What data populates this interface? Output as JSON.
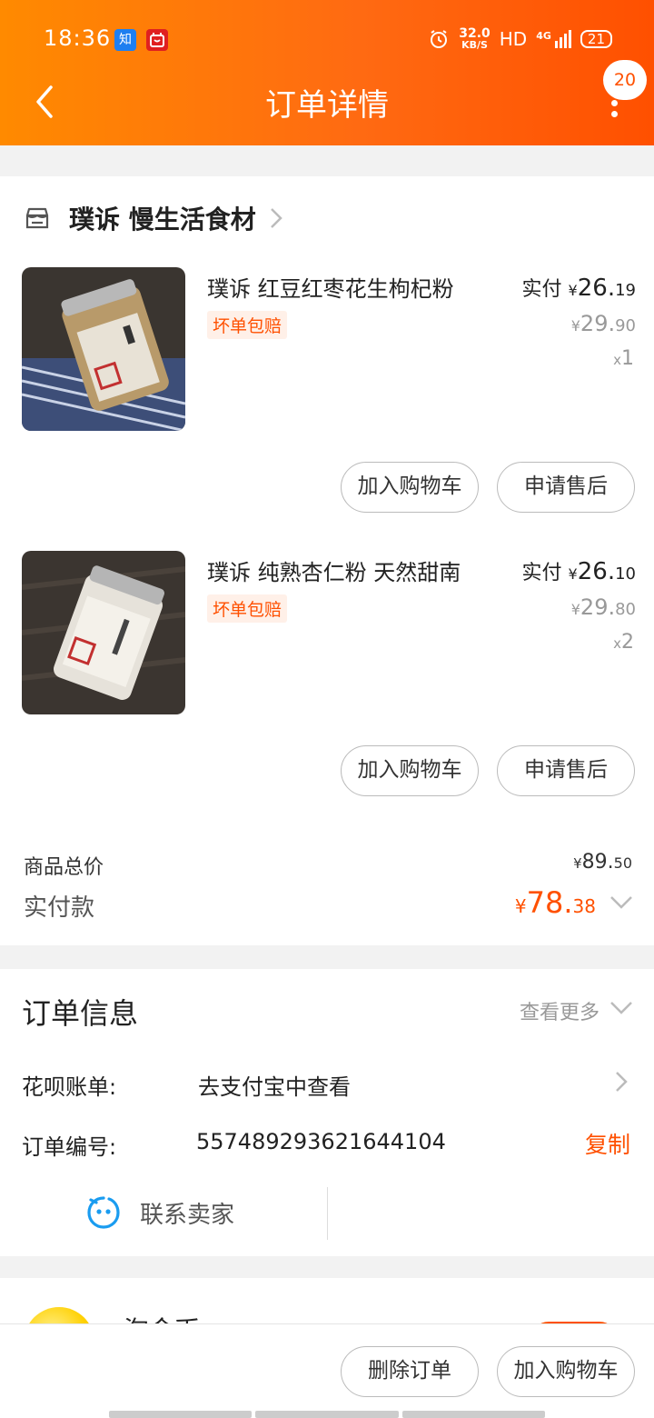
{
  "status_bar": {
    "time": "18:36",
    "app_icon_1": "知",
    "net_speed_value": "32.0",
    "net_speed_unit": "KB/S",
    "hd": "HD",
    "signal": "4G",
    "battery": "21"
  },
  "nav": {
    "title": "订单详情",
    "message_count": "20"
  },
  "shop": {
    "name": "璞诉 慢生活食材"
  },
  "products": [
    {
      "title": "璞诉 红豆红枣花生枸杞粉",
      "tag": "坏单包赔",
      "paid_label": "实付",
      "paid_yen": "¥",
      "paid_int": "26.",
      "paid_dec": "19",
      "orig_yen": "¥",
      "orig_int": "29.",
      "orig_dec": "90",
      "qty_x": "x",
      "qty": "1",
      "btn_cart": "加入购物车",
      "btn_after_sale": "申请售后"
    },
    {
      "title": "璞诉 纯熟杏仁粉 天然甜南",
      "tag": "坏单包赔",
      "paid_label": "实付",
      "paid_yen": "¥",
      "paid_int": "26.",
      "paid_dec": "10",
      "orig_yen": "¥",
      "orig_int": "29.",
      "orig_dec": "80",
      "qty_x": "x",
      "qty": "2",
      "btn_cart": "加入购物车",
      "btn_after_sale": "申请售后"
    }
  ],
  "summary": {
    "total_label": "商品总价",
    "total_yen": "¥",
    "total_int": "89.",
    "total_dec": "50",
    "paid_label": "实付款",
    "paid_yen": "¥",
    "paid_int": "78.",
    "paid_dec": "38"
  },
  "order_info": {
    "title": "订单信息",
    "more": "查看更多",
    "huabei_label": "花呗账单:",
    "huabei_value": "去支付宝中查看",
    "order_no_label": "订单编号:",
    "order_no_value": "557489293621644104",
    "copy": "复制",
    "contact": "联系卖家"
  },
  "promo": {
    "name": "淘金币"
  },
  "bottom": {
    "delete": "删除订单",
    "add_cart": "加入购物车"
  },
  "colors": {
    "accent": "#ff5000",
    "header_start": "#ff8a00",
    "header_end": "#ff5000",
    "tag_bg": "#fff0e8"
  }
}
